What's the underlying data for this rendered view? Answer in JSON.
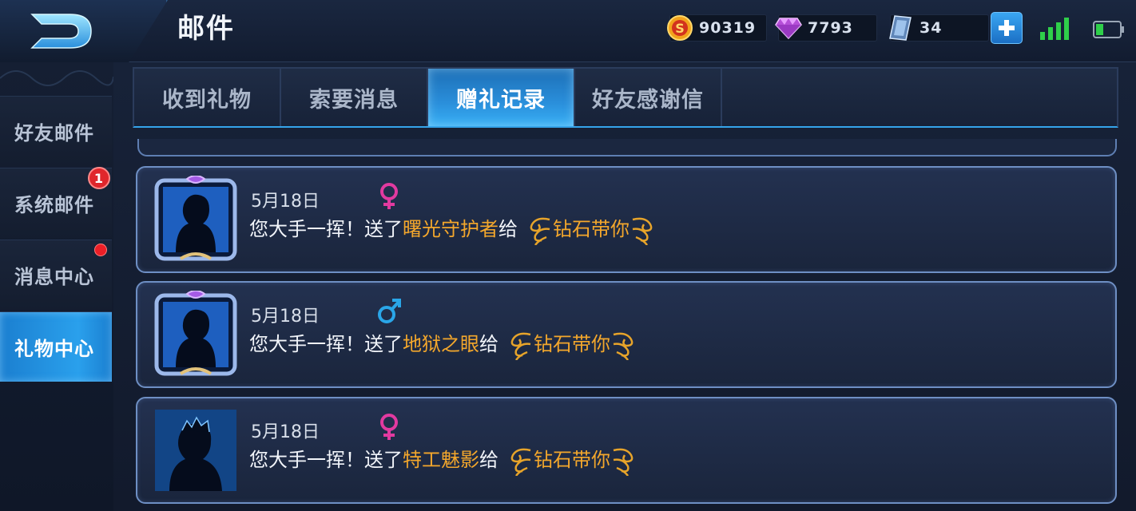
{
  "header": {
    "title": "邮件",
    "resources": {
      "gold": "90319",
      "diamond": "7793",
      "voucher": "34"
    },
    "icons": {
      "back": "back-arrow-icon",
      "gold": "gold-coin-icon",
      "diamond": "diamond-icon",
      "voucher": "voucher-card-icon",
      "add": "plus-icon",
      "signal": "signal-icon",
      "battery": "battery-icon"
    }
  },
  "sidebar": {
    "items": [
      {
        "label": "好友邮件"
      },
      {
        "label": "系统邮件",
        "badge": "1"
      },
      {
        "label": "消息中心"
      },
      {
        "label": "礼物中心"
      }
    ],
    "active_index": 3
  },
  "tabs": {
    "items": [
      {
        "label": "收到礼物"
      },
      {
        "label": "索要消息"
      },
      {
        "label": "赠礼记录"
      },
      {
        "label": "好友感谢信"
      }
    ],
    "active_index": 2
  },
  "records": [
    {
      "date": "5月18日",
      "gender": "female",
      "prefix": "您大手一挥！送了",
      "item": "曙光守护者",
      "mid": "给",
      "friend": "钻石带你"
    },
    {
      "date": "5月18日",
      "gender": "male",
      "prefix": "您大手一挥！送了",
      "item": "地狱之眼",
      "mid": "给",
      "friend": "钻石带你"
    },
    {
      "date": "5月18日",
      "gender": "female",
      "prefix": "您大手一挥！送了",
      "item": "特工魅影",
      "mid": "给",
      "friend": "钻石带你"
    }
  ],
  "colors": {
    "accent": "#2a9ae8",
    "highlight_text": "#f3a72c",
    "female": "#e23aa0",
    "male": "#2aa6e8",
    "badge": "#e0262c"
  }
}
